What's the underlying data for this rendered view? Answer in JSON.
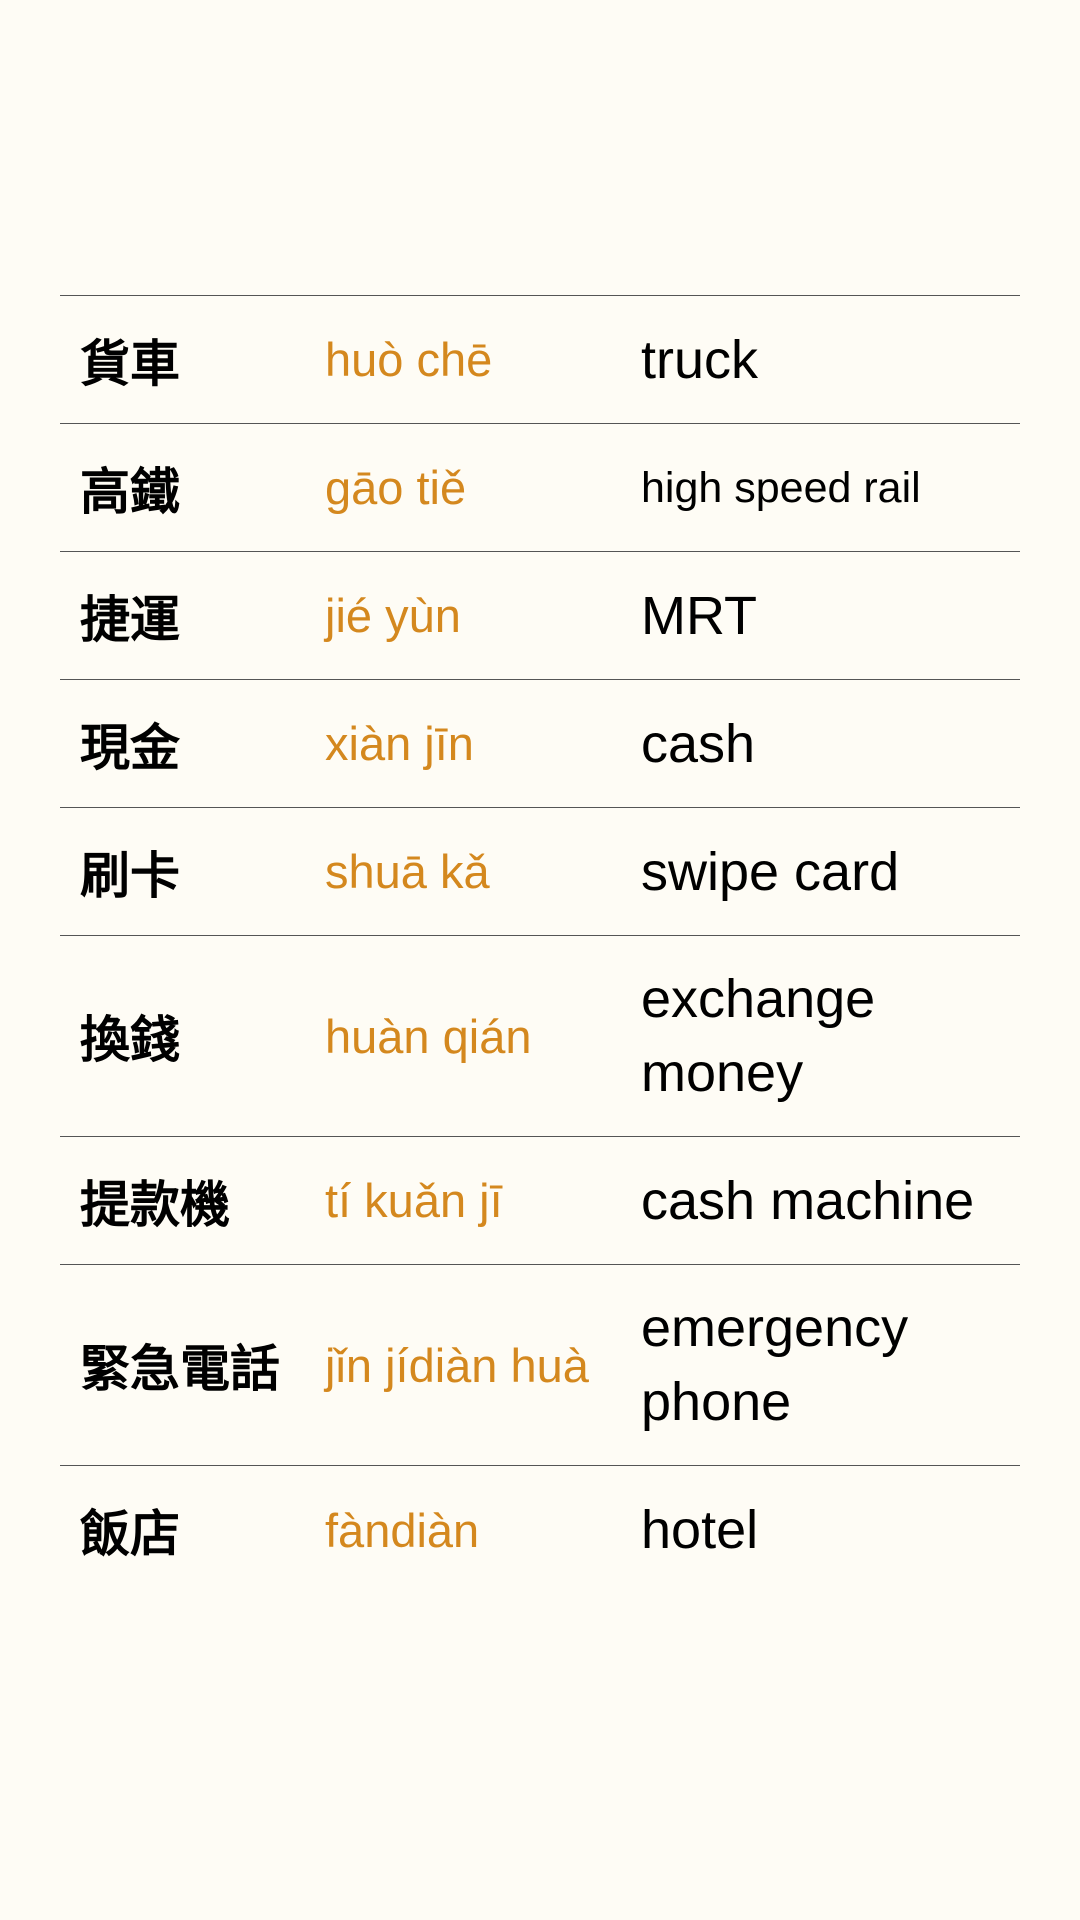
{
  "colors": {
    "background": "#fefcf5",
    "pinyin": "#d4881e",
    "text": "#000000",
    "divider": "#555555"
  },
  "vocab": [
    {
      "hanzi": "貨車",
      "pinyin": "huò chē",
      "english": "truck"
    },
    {
      "hanzi": "高鐵",
      "pinyin": "gāo tiě",
      "english": "high speed rail"
    },
    {
      "hanzi": "捷運",
      "pinyin": "jié yùn",
      "english": "MRT"
    },
    {
      "hanzi": "現金",
      "pinyin": "xiàn jīn",
      "english": "cash"
    },
    {
      "hanzi": "刷卡",
      "pinyin": "shuā kǎ",
      "english": "swipe card"
    },
    {
      "hanzi": "換錢",
      "pinyin": "huàn qián",
      "english": "exchange money"
    },
    {
      "hanzi": "提款機",
      "pinyin": "tí kuǎn jī",
      "english": "cash machine"
    },
    {
      "hanzi": "緊急電話",
      "pinyin": "jǐn jídiàn huà",
      "english": "emergency phone"
    },
    {
      "hanzi": "飯店",
      "pinyin": "fàndiàn",
      "english": "hotel"
    }
  ]
}
